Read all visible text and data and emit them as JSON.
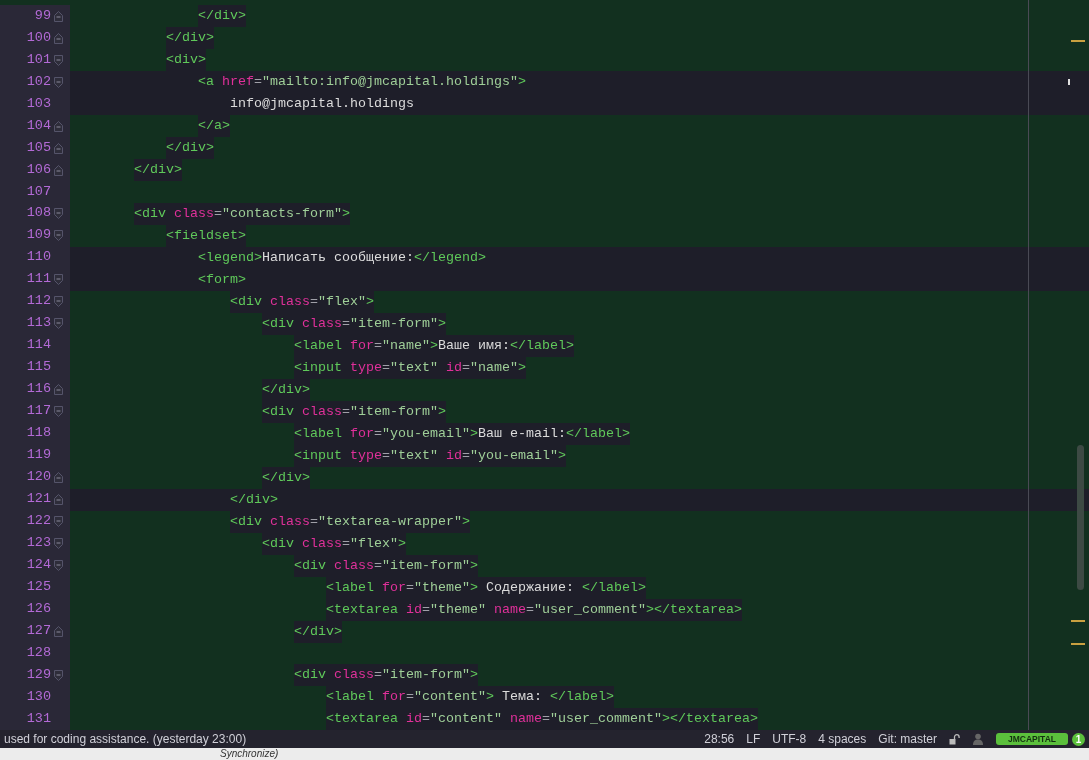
{
  "editor": {
    "lines": [
      {
        "number": "99",
        "kind": "closing",
        "highlighted": false,
        "tokens": [
          {
            "kind": "tag",
            "text": "</div>"
          }
        ]
      },
      {
        "number": "100",
        "kind": "closing",
        "highlighted": false,
        "tokens": [
          {
            "kind": "tag",
            "text": "</div>"
          }
        ]
      },
      {
        "number": "101",
        "kind": "opening",
        "highlighted": false,
        "tokens": [
          {
            "kind": "tag",
            "text": "<div>"
          }
        ]
      },
      {
        "number": "102",
        "kind": "opening",
        "highlighted": true,
        "tokens": [
          {
            "kind": "tag",
            "text": "<a "
          },
          {
            "kind": "attr",
            "text": "href"
          },
          {
            "kind": "punct",
            "text": "="
          },
          {
            "kind": "string",
            "text": "\"mailto:info@jmcapital.holdings\""
          },
          {
            "kind": "tag",
            "text": ">"
          }
        ]
      },
      {
        "number": "103",
        "kind": "plain",
        "highlighted": true,
        "tokens": [
          {
            "kind": "text",
            "text": "info@jmcapital.holdings"
          }
        ]
      },
      {
        "number": "104",
        "kind": "closing",
        "highlighted": false,
        "tokens": [
          {
            "kind": "tag",
            "text": "</a>"
          }
        ]
      },
      {
        "number": "105",
        "kind": "closing",
        "highlighted": false,
        "tokens": [
          {
            "kind": "tag",
            "text": "</div>"
          }
        ]
      },
      {
        "number": "106",
        "kind": "closing",
        "highlighted": false,
        "tokens": [
          {
            "kind": "tag",
            "text": "</div>"
          }
        ]
      },
      {
        "number": "107",
        "kind": "plain",
        "highlighted": false
      },
      {
        "number": "108",
        "kind": "opening",
        "highlighted": false,
        "tokens": [
          {
            "kind": "tag",
            "text": "<div "
          },
          {
            "kind": "attr",
            "text": "class"
          },
          {
            "kind": "punct",
            "text": "="
          },
          {
            "kind": "string",
            "text": "\"contacts-form\""
          },
          {
            "kind": "tag",
            "text": ">"
          }
        ]
      },
      {
        "number": "109",
        "kind": "opening",
        "highlighted": false,
        "tokens": [
          {
            "kind": "tag",
            "text": "<fieldset>"
          }
        ]
      },
      {
        "number": "110",
        "kind": "plain",
        "highlighted": true,
        "tokens": [
          {
            "kind": "tag",
            "text": "<legend>"
          },
          {
            "kind": "text",
            "text": "Написать сообщение:"
          },
          {
            "kind": "tag",
            "text": "</legend>"
          }
        ]
      },
      {
        "number": "111",
        "kind": "opening",
        "highlighted": true,
        "tokens": [
          {
            "kind": "tag",
            "text": "<form>"
          }
        ]
      },
      {
        "number": "112",
        "kind": "opening",
        "highlighted": false,
        "tokens": [
          {
            "kind": "tag",
            "text": "<div "
          },
          {
            "kind": "attr",
            "text": "class"
          },
          {
            "kind": "punct",
            "text": "="
          },
          {
            "kind": "string",
            "text": "\"flex\""
          },
          {
            "kind": "tag",
            "text": ">"
          }
        ]
      },
      {
        "number": "113",
        "kind": "opening",
        "highlighted": false,
        "tokens": [
          {
            "kind": "tag",
            "text": "<div "
          },
          {
            "kind": "attr",
            "text": "class"
          },
          {
            "kind": "punct",
            "text": "="
          },
          {
            "kind": "string",
            "text": "\"item-form\""
          },
          {
            "kind": "tag",
            "text": ">"
          }
        ]
      },
      {
        "number": "114",
        "kind": "plain",
        "highlighted": false,
        "tokens": [
          {
            "kind": "tag",
            "text": "<label "
          },
          {
            "kind": "attr",
            "text": "for"
          },
          {
            "kind": "punct",
            "text": "="
          },
          {
            "kind": "string",
            "text": "\"name\""
          },
          {
            "kind": "tag",
            "text": ">"
          },
          {
            "kind": "text",
            "text": "Ваше имя:"
          },
          {
            "kind": "tag",
            "text": "</label>"
          }
        ]
      },
      {
        "number": "115",
        "kind": "plain",
        "highlighted": false,
        "tokens": [
          {
            "kind": "tag",
            "text": "<input "
          },
          {
            "kind": "attr",
            "text": "type"
          },
          {
            "kind": "punct",
            "text": "="
          },
          {
            "kind": "string",
            "text": "\"text\" "
          },
          {
            "kind": "attr",
            "text": "id"
          },
          {
            "kind": "punct",
            "text": "="
          },
          {
            "kind": "string",
            "text": "\"name\""
          },
          {
            "kind": "tag",
            "text": ">"
          }
        ]
      },
      {
        "number": "116",
        "kind": "closing",
        "highlighted": false,
        "tokens": [
          {
            "kind": "tag",
            "text": "</div>"
          }
        ]
      },
      {
        "number": "117",
        "kind": "opening",
        "highlighted": false,
        "tokens": [
          {
            "kind": "tag",
            "text": "<div "
          },
          {
            "kind": "attr",
            "text": "class"
          },
          {
            "kind": "punct",
            "text": "="
          },
          {
            "kind": "string",
            "text": "\"item-form\""
          },
          {
            "kind": "tag",
            "text": ">"
          }
        ]
      },
      {
        "number": "118",
        "kind": "plain",
        "highlighted": false,
        "tokens": [
          {
            "kind": "tag",
            "text": "<label "
          },
          {
            "kind": "attr",
            "text": "for"
          },
          {
            "kind": "punct",
            "text": "="
          },
          {
            "kind": "string",
            "text": "\"you-email\""
          },
          {
            "kind": "tag",
            "text": ">"
          },
          {
            "kind": "text",
            "text": "Ваш e-mail:"
          },
          {
            "kind": "tag",
            "text": "</label>"
          }
        ]
      },
      {
        "number": "119",
        "kind": "plain",
        "highlighted": false,
        "tokens": [
          {
            "kind": "tag",
            "text": "<input "
          },
          {
            "kind": "attr",
            "text": "type"
          },
          {
            "kind": "punct",
            "text": "="
          },
          {
            "kind": "string",
            "text": "\"text\" "
          },
          {
            "kind": "attr",
            "text": "id"
          },
          {
            "kind": "punct",
            "text": "="
          },
          {
            "kind": "string",
            "text": "\"you-email\""
          },
          {
            "kind": "tag",
            "text": ">"
          }
        ]
      },
      {
        "number": "120",
        "kind": "closing",
        "highlighted": false,
        "tokens": [
          {
            "kind": "tag",
            "text": "</div>"
          }
        ]
      },
      {
        "number": "121",
        "kind": "closing",
        "highlighted": true,
        "tokens": [
          {
            "kind": "tag",
            "text": "</div>"
          }
        ]
      },
      {
        "number": "122",
        "kind": "opening",
        "highlighted": false,
        "tokens": [
          {
            "kind": "tag",
            "text": "<div "
          },
          {
            "kind": "attr",
            "text": "class"
          },
          {
            "kind": "punct",
            "text": "="
          },
          {
            "kind": "string",
            "text": "\"textarea-wrapper\""
          },
          {
            "kind": "tag",
            "text": ">"
          }
        ]
      },
      {
        "number": "123",
        "kind": "opening",
        "highlighted": false,
        "tokens": [
          {
            "kind": "tag",
            "text": "<div "
          },
          {
            "kind": "attr",
            "text": "class"
          },
          {
            "kind": "punct",
            "text": "="
          },
          {
            "kind": "string",
            "text": "\"flex\""
          },
          {
            "kind": "tag",
            "text": ">"
          }
        ]
      },
      {
        "number": "124",
        "kind": "opening",
        "highlighted": false,
        "tokens": [
          {
            "kind": "tag",
            "text": "<div "
          },
          {
            "kind": "attr",
            "text": "class"
          },
          {
            "kind": "punct",
            "text": "="
          },
          {
            "kind": "string",
            "text": "\"item-form\""
          },
          {
            "kind": "tag",
            "text": ">"
          }
        ]
      },
      {
        "number": "125",
        "kind": "plain",
        "highlighted": false,
        "tokens": [
          {
            "kind": "tag",
            "text": "<label "
          },
          {
            "kind": "attr",
            "text": "for"
          },
          {
            "kind": "punct",
            "text": "="
          },
          {
            "kind": "string",
            "text": "\"theme\""
          },
          {
            "kind": "tag",
            "text": ">"
          },
          {
            "kind": "text",
            "text": " Содержание: "
          },
          {
            "kind": "tag",
            "text": "</label>"
          }
        ]
      },
      {
        "number": "126",
        "kind": "plain",
        "highlighted": false,
        "tokens": [
          {
            "kind": "tag",
            "text": "<textarea "
          },
          {
            "kind": "attr",
            "text": "id"
          },
          {
            "kind": "punct",
            "text": "="
          },
          {
            "kind": "string",
            "text": "\"theme\" "
          },
          {
            "kind": "attr",
            "text": "name"
          },
          {
            "kind": "punct",
            "text": "="
          },
          {
            "kind": "string",
            "text": "\"user_comment\""
          },
          {
            "kind": "tag",
            "text": "></textarea>"
          }
        ]
      },
      {
        "number": "127",
        "kind": "closing",
        "highlighted": false,
        "tokens": [
          {
            "kind": "tag",
            "text": "</div>"
          }
        ]
      },
      {
        "number": "128",
        "kind": "plain",
        "highlighted": false
      },
      {
        "number": "129",
        "kind": "opening",
        "highlighted": false,
        "tokens": [
          {
            "kind": "tag",
            "text": "<div "
          },
          {
            "kind": "attr",
            "text": "class"
          },
          {
            "kind": "punct",
            "text": "="
          },
          {
            "kind": "string",
            "text": "\"item-form\""
          },
          {
            "kind": "tag",
            "text": ">"
          }
        ]
      },
      {
        "number": "130",
        "kind": "plain",
        "highlighted": false,
        "tokens": [
          {
            "kind": "tag",
            "text": "<label "
          },
          {
            "kind": "attr",
            "text": "for"
          },
          {
            "kind": "punct",
            "text": "="
          },
          {
            "kind": "string",
            "text": "\"content\""
          },
          {
            "kind": "tag",
            "text": ">"
          },
          {
            "kind": "text",
            "text": " Тема: "
          },
          {
            "kind": "tag",
            "text": "</label>"
          }
        ]
      },
      {
        "number": "131",
        "kind": "plain",
        "highlighted": false,
        "tokens": [
          {
            "kind": "tag",
            "text": "<textarea "
          },
          {
            "kind": "attr",
            "text": "id"
          },
          {
            "kind": "punct",
            "text": "="
          },
          {
            "kind": "string",
            "text": "\"content\" "
          },
          {
            "kind": "attr",
            "text": "name"
          },
          {
            "kind": "punct",
            "text": "="
          },
          {
            "kind": "string",
            "text": "\"user_comment\""
          },
          {
            "kind": "tag",
            "text": "></textarea>"
          }
        ]
      }
    ]
  },
  "status_bar": {
    "message": "used for coding assistance. (yesterday 23:00)",
    "cursor": "28:56",
    "line_ending": "LF",
    "encoding": "UTF-8",
    "indentation": "4 spaces",
    "git_branch": "Git: master",
    "badge": "JMCAPITAL",
    "count": "1"
  },
  "tooltip": {
    "text": "Synchronize)"
  }
}
